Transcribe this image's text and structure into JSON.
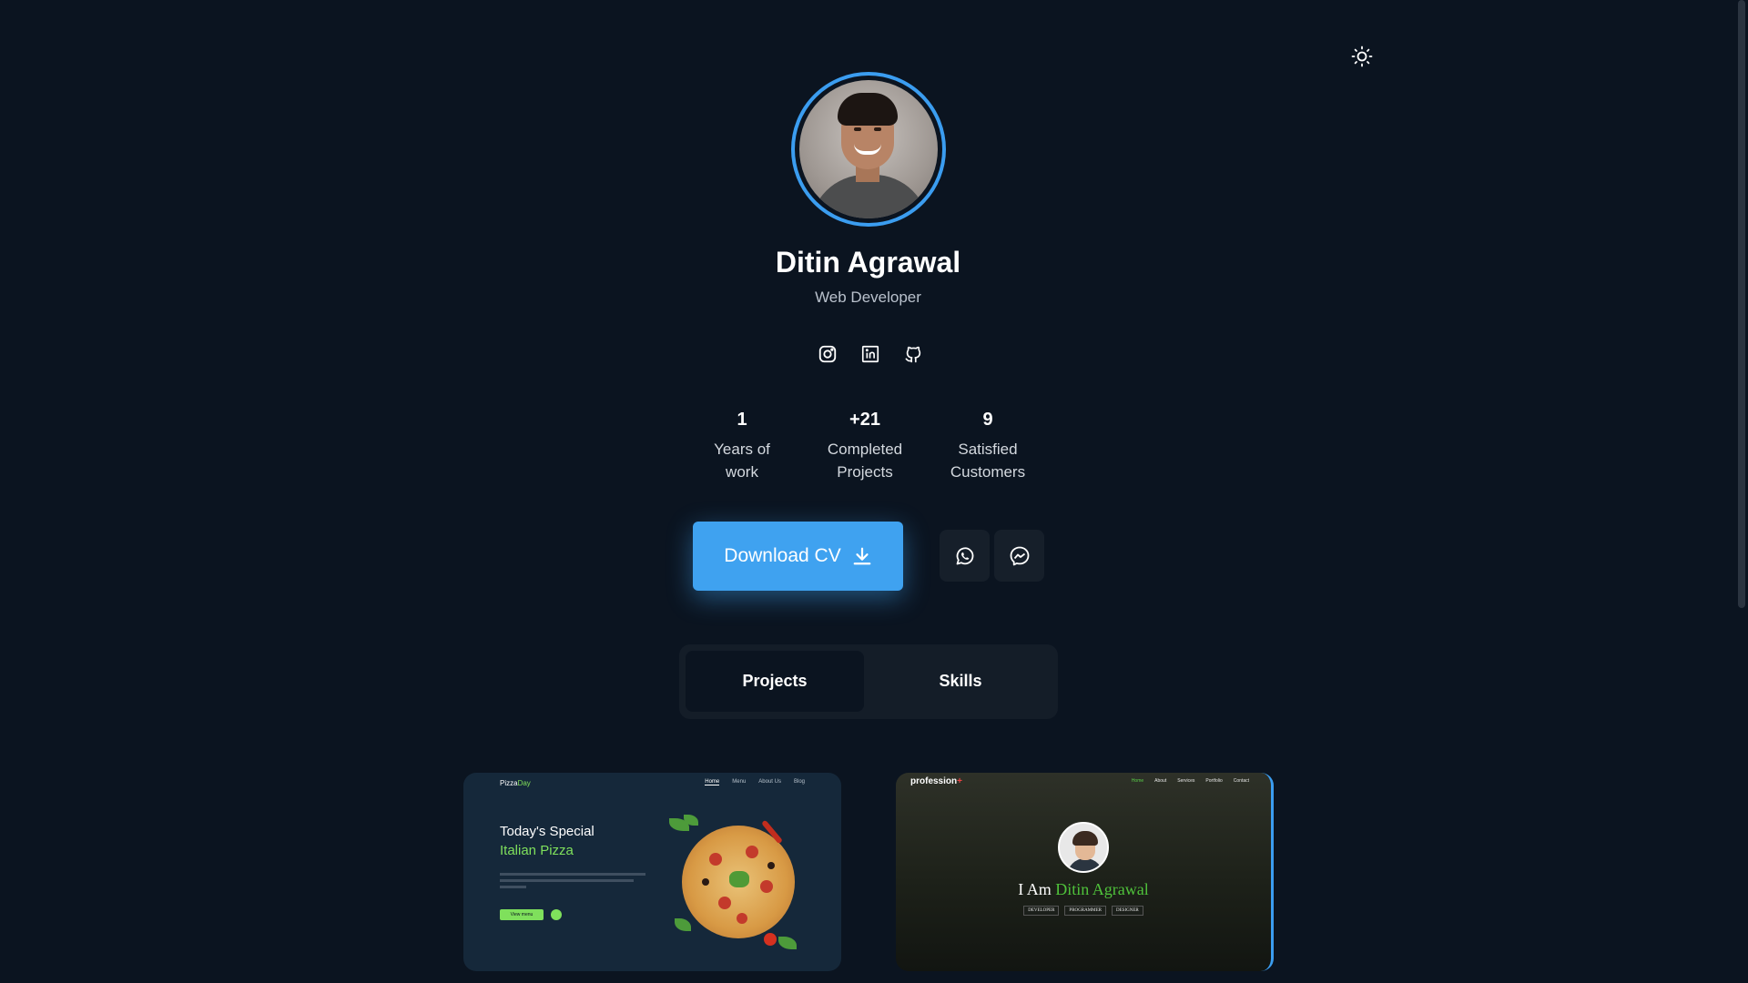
{
  "profile": {
    "name": "Ditin Agrawal",
    "role": "Web Developer"
  },
  "socials": [
    {
      "icon": "instagram-icon"
    },
    {
      "icon": "linkedin-icon"
    },
    {
      "icon": "github-icon"
    }
  ],
  "stats": [
    {
      "value": "1",
      "label_line1": "Years of",
      "label_line2": "work"
    },
    {
      "value": "+21",
      "label_line1": "Completed",
      "label_line2": "Projects"
    },
    {
      "value": "9",
      "label_line1": "Satisfied",
      "label_line2": "Customers"
    }
  ],
  "actions": {
    "download_label": "Download CV",
    "download_icon": "download-icon",
    "whatsapp_icon": "whatsapp-icon",
    "messenger_icon": "messenger-icon"
  },
  "tabs": [
    {
      "label": "Projects",
      "active": true
    },
    {
      "label": "Skills",
      "active": false
    }
  ],
  "projects": [
    {
      "logo_main": "Pizza",
      "logo_accent": "Day",
      "nav": [
        "Home",
        "Menu",
        "About Us",
        "Blog"
      ],
      "title": "Today's Special",
      "subtitle": "Italian Pizza",
      "button": "View menu"
    },
    {
      "logo_main": "profession",
      "logo_accent": "+",
      "nav": [
        "Home",
        "About",
        "Services",
        "Portfolio",
        "Contact"
      ],
      "title_prefix": "I Am",
      "title_name": "Ditin Agrawal",
      "tags": [
        "DEVELOPER",
        "PROGRAMMER",
        "DESIGNER"
      ]
    }
  ],
  "colors": {
    "background": "#0b1420",
    "accent": "#3fa2f0",
    "green": "#7fe05c"
  }
}
